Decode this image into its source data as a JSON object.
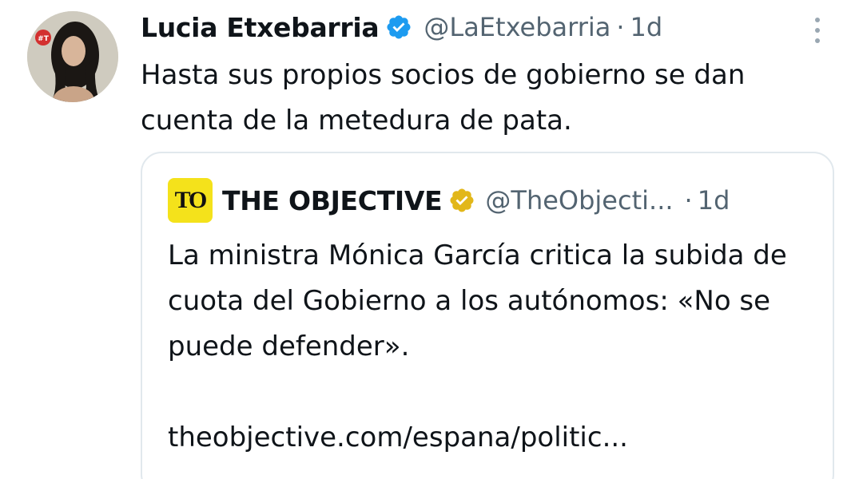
{
  "author": {
    "display_name": "Lucia Etxebarria",
    "handle": "@LaEtxebarria",
    "separator": "·",
    "time": "1d",
    "verified_color": "#1d9bf0",
    "avatar_badge": "#T"
  },
  "tweet": {
    "text": "Hasta sus propios socios de gobierno se dan cuenta de la metedura de pata."
  },
  "menu": {
    "icon": "more-vertical-icon"
  },
  "quoted": {
    "logo_text": "TO",
    "logo_color": "#f4e21b",
    "display_name": "THE OBJECTIVE",
    "handle": "@TheObjecti...",
    "separator": "·",
    "time": "1d",
    "verified_color": "#e2b719",
    "text": "La ministra Mónica García critica la subida de cuota del Gobierno a los autónomos: «No se puede defender».",
    "link": "theobjective.com/espana/politic..."
  }
}
